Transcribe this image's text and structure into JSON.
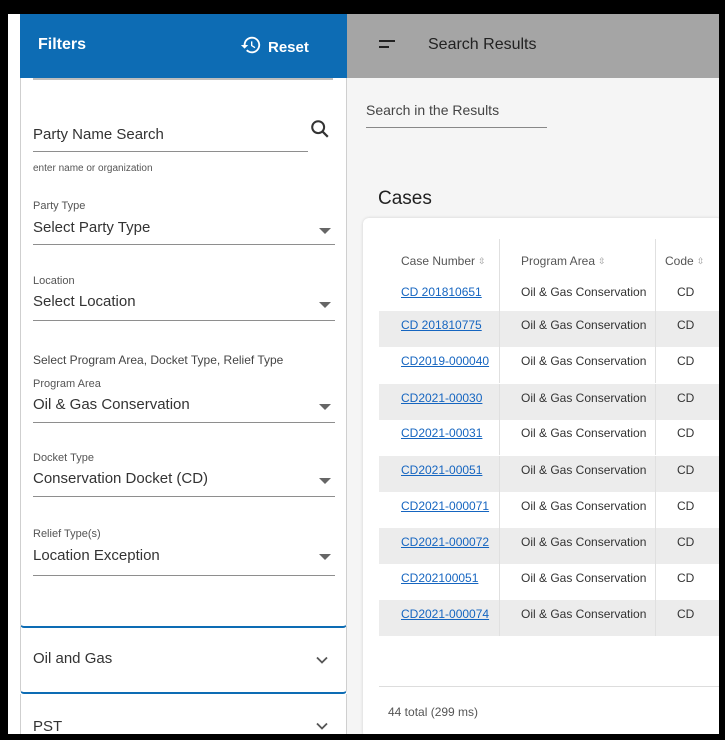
{
  "filters": {
    "title": "Filters",
    "reset_label": "Reset",
    "party_search": {
      "value": "Party Name Search",
      "hint": "enter name or organization"
    },
    "party_type": {
      "label": "Party Type",
      "value": "Select Party Type"
    },
    "location": {
      "label": "Location",
      "value": "Select Location"
    },
    "program_note": "Select Program Area, Docket Type, Relief Type",
    "program_area": {
      "label": "Program Area",
      "value": "Oil & Gas Conservation"
    },
    "docket_type": {
      "label": "Docket Type",
      "value": "Conservation Docket (CD)"
    },
    "relief_type": {
      "label": "Relief Type(s)",
      "value": "Location Exception"
    },
    "accordions": [
      {
        "label": "Oil and Gas"
      },
      {
        "label": "PST"
      }
    ]
  },
  "results": {
    "title": "Search Results",
    "search_placeholder": "Search in the Results",
    "cases_title": "Cases",
    "columns": [
      "Case Number",
      "Program Area",
      "Code"
    ],
    "rows": [
      {
        "case": "CD 201810651",
        "area": "Oil & Gas Conservation",
        "code": "CD"
      },
      {
        "case": "CD 201810775",
        "area": "Oil & Gas Conservation",
        "code": "CD"
      },
      {
        "case": "CD2019-000040",
        "area": "Oil & Gas Conservation",
        "code": "CD"
      },
      {
        "case": "CD2021-00030",
        "area": "Oil & Gas Conservation",
        "code": "CD"
      },
      {
        "case": "CD2021-00031",
        "area": "Oil & Gas Conservation",
        "code": "CD"
      },
      {
        "case": "CD2021-00051",
        "area": "Oil & Gas Conservation",
        "code": "CD"
      },
      {
        "case": "CD2021-000071",
        "area": "Oil & Gas Conservation",
        "code": "CD"
      },
      {
        "case": "CD2021-000072",
        "area": "Oil & Gas Conservation",
        "code": "CD"
      },
      {
        "case": "CD202100051",
        "area": "Oil & Gas Conservation",
        "code": "CD"
      },
      {
        "case": "CD2021-000074",
        "area": "Oil & Gas Conservation",
        "code": "CD"
      }
    ],
    "footer": "44 total (299 ms)"
  },
  "colors": {
    "accent": "#0d6cb4",
    "header_gray": "#a5a5a5",
    "link": "#1565c0"
  },
  "icons": [
    "reset-icon",
    "search-icon",
    "chevron-down-icon",
    "hamburger-icon"
  ]
}
